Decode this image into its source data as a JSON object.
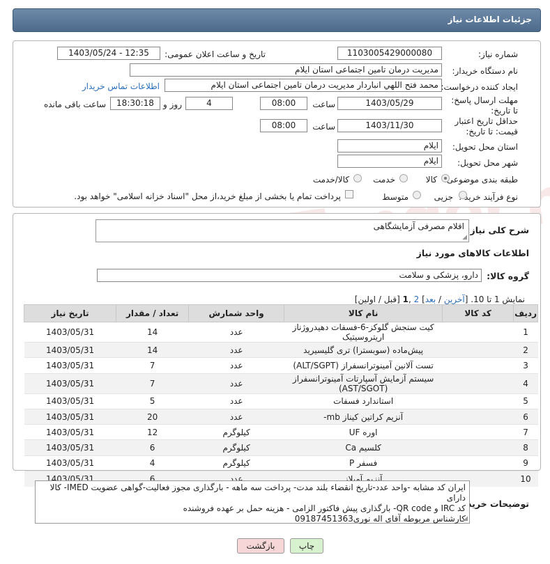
{
  "header": {
    "title": "جزئیات اطلاعات نیاز"
  },
  "watermark": "AriaTender.net",
  "form": {
    "need_number_label": "شماره نیاز:",
    "need_number": "1103005429000080",
    "announce_label": "تاریخ و ساعت اعلان عمومی:",
    "announce_value": "1403/05/24 - 12:35",
    "buyer_org_label": "نام دستگاه خریدار:",
    "buyer_org": "مدیریت درمان تامین اجتماعی استان ایلام",
    "creator_label": "ایجاد کننده درخواست:",
    "creator": "محمد فتح اللهي انباردار مدیریت درمان تامین اجتماعی استان ایلام",
    "contact_link": "اطلاعات تماس خریدار",
    "reply_deadline_label": "مهلت ارسال پاسخ: تا تاریخ:",
    "reply_date": "1403/05/29",
    "time_label": "ساعت",
    "reply_time": "08:00",
    "days_value": "4",
    "days_label": "روز و",
    "remaining_time": "18:30:18",
    "remaining_label": "ساعت باقی مانده",
    "validity_label": "حداقل تاریخ اعتبار قیمت: تا تاریخ:",
    "validity_date": "1403/11/30",
    "validity_time": "08:00",
    "province_label": "استان محل تحویل:",
    "province": "ایلام",
    "city_label": "شهر محل تحویل:",
    "city": "ایلام",
    "category_label": "طبقه بندی موضوعی:",
    "category_options": [
      "کالا",
      "خدمت",
      "کالا/خدمت"
    ],
    "process_label": "نوع فرآیند خرید :",
    "process_options": [
      "جزیی",
      "متوسط"
    ],
    "payment_note": "پرداخت تمام یا بخشی از مبلغ خرید،از محل \"اسناد خزانه اسلامی\" خواهد بود."
  },
  "summary": {
    "label": "شرح کلی نیاز:",
    "value": "اقلام مصرفی آزمایشگاهی"
  },
  "goods_section_title": "اطلاعات کالاهای مورد نیاز",
  "goods_group": {
    "label": "گروه کالا:",
    "value": "دارو، پزشکی و سلامت"
  },
  "pagination": {
    "prefix": "نمایش 1 تا 10. [",
    "last": "آخرین",
    "sep1": " / ",
    "next": "بعد",
    "sep2": "] ",
    "page2": "2",
    "comma": " ,",
    "page1": "1",
    "suffix": " [قبل / اولین]"
  },
  "table": {
    "headers": [
      "ردیف",
      "کد کالا",
      "نام کالا",
      "واحد شمارش",
      "تعداد / مقدار",
      "تاریخ نیاز"
    ],
    "rows": [
      {
        "n": "1",
        "code": "",
        "name": "کیت سنجش گلوکز-6-فسفات دهیدروژناز اریتروسیتیک",
        "unit": "عدد",
        "qty": "14",
        "date": "1403/05/31"
      },
      {
        "n": "2",
        "code": "",
        "name": "پیش‌ماده (سوبسترا) تری گلیسیرید",
        "unit": "عدد",
        "qty": "14",
        "date": "1403/05/31"
      },
      {
        "n": "3",
        "code": "",
        "name": "تست آلانین آمینوترانسفراز (ALT/SGPT)",
        "unit": "عدد",
        "qty": "7",
        "date": "1403/05/31"
      },
      {
        "n": "4",
        "code": "",
        "name": "سیستم آزمایش آسپارتات آمینوترانسفراز (AST/SGOT)",
        "unit": "عدد",
        "qty": "7",
        "date": "1403/05/31"
      },
      {
        "n": "5",
        "code": "",
        "name": "استاندارد فسفات",
        "unit": "عدد",
        "qty": "5",
        "date": "1403/05/31"
      },
      {
        "n": "6",
        "code": "",
        "name": "آنزیم کراتین کیناز mb-",
        "unit": "عدد",
        "qty": "20",
        "date": "1403/05/31"
      },
      {
        "n": "7",
        "code": "",
        "name": "اوره UF",
        "unit": "کیلوگرم",
        "qty": "12",
        "date": "1403/05/31"
      },
      {
        "n": "8",
        "code": "",
        "name": "کلسیم Ca",
        "unit": "کیلوگرم",
        "qty": "6",
        "date": "1403/05/31"
      },
      {
        "n": "9",
        "code": "",
        "name": "فسفر P",
        "unit": "کیلوگرم",
        "qty": "4",
        "date": "1403/05/31"
      },
      {
        "n": "10",
        "code": "",
        "name": "آنزیم آمیلاز",
        "unit": "عدد",
        "qty": "6",
        "date": "1403/05/31"
      }
    ]
  },
  "buyer_notes": {
    "label": "توضیحات خریدار:",
    "line1": "ایران کد مشابه -واحد عدد-تاریخ انقضاء بلند مدت- پرداخت سه ماهه - بارگذاری مجوز فعالیت-گواهی عضویت IMED- کالا دارای",
    "line2": "کد IRC و QR code- بارگذاری پیش فاکتور الزامی - هزینه حمل بر عهده فروشنده",
    "line3": "کارشناس مربوطه آقای اله نوری09187451363"
  },
  "buttons": {
    "print": "چاپ",
    "back": "بازگشت"
  },
  "colors": {
    "header_bg": "#5b7898",
    "link": "#2a6ebb",
    "print_btn": "#d8f2cf",
    "back_btn": "#f6d6d6"
  }
}
